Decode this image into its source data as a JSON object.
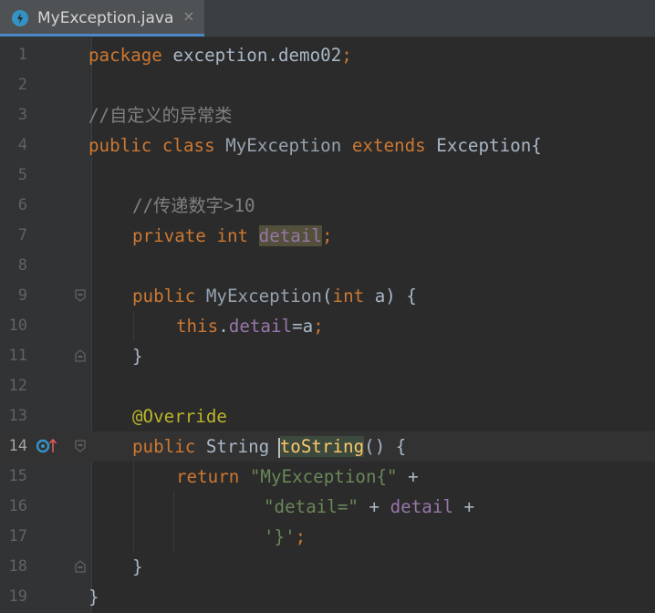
{
  "tab": {
    "filename": "MyException.java",
    "close_glyph": "×",
    "icon": "java-class-icon"
  },
  "lines": [
    {
      "n": "1"
    },
    {
      "n": "2"
    },
    {
      "n": "3"
    },
    {
      "n": "4"
    },
    {
      "n": "5"
    },
    {
      "n": "6"
    },
    {
      "n": "7"
    },
    {
      "n": "8"
    },
    {
      "n": "9"
    },
    {
      "n": "10"
    },
    {
      "n": "11"
    },
    {
      "n": "12"
    },
    {
      "n": "13"
    },
    {
      "n": "14"
    },
    {
      "n": "15"
    },
    {
      "n": "16"
    },
    {
      "n": "17"
    },
    {
      "n": "18"
    },
    {
      "n": "19"
    }
  ],
  "code": {
    "l1": {
      "kw": "package",
      "rest": " exception.demo02",
      "semi": ";"
    },
    "l3": {
      "comment": "//自定义的异常类"
    },
    "l4": {
      "kw1": "public",
      "kw2": "class",
      "name": "MyException",
      "kw3": "extends",
      "parent": "Exception",
      "brace": "{"
    },
    "l6": {
      "comment": "//传递数字>10"
    },
    "l7": {
      "kw1": "private",
      "kw2": "int",
      "field": "detail",
      "semi": ";"
    },
    "l9": {
      "kw1": "public",
      "name": "MyException",
      "open": "(",
      "kw2": "int",
      "rest": " a) {"
    },
    "l10": {
      "kw": "this",
      "dot": ".",
      "field": "detail",
      "rest": "=a",
      "semi": ";"
    },
    "l11": {
      "text": "}"
    },
    "l13": {
      "ann": "@Override"
    },
    "l14": {
      "kw": "public",
      "type": " String ",
      "method": "toString",
      "rest": "() {"
    },
    "l15": {
      "kw": "return",
      "str": "\"MyException{\"",
      "rest": " +"
    },
    "l16": {
      "str": "\"detail=\"",
      "plus": " + ",
      "field": "detail",
      "rest": " +"
    },
    "l17": {
      "str": "'}'",
      "semi": ";"
    },
    "l18": {
      "text": "}"
    },
    "l19": {
      "text": "}"
    }
  },
  "current_line": "14",
  "gutter_icons": {
    "l14": [
      "overrides-method-icon",
      "implements-arrow-icon"
    ]
  }
}
